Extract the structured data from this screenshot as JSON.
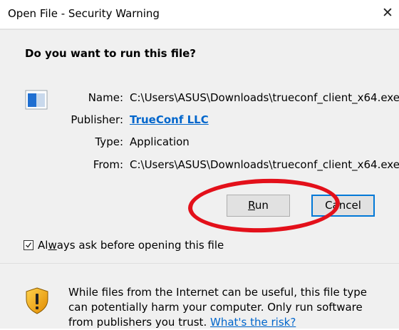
{
  "window": {
    "title": "Open File - Security Warning",
    "close_glyph": "✕"
  },
  "dialog": {
    "question": "Do you want to run this file?",
    "details": [
      {
        "label": "Name:",
        "value": "C:\\Users\\ASUS\\Downloads\\trueconf_client_x64.exe"
      },
      {
        "label": "Publisher:",
        "value": "TrueConf LLC"
      },
      {
        "label": "Type:",
        "value": "Application"
      },
      {
        "label": "From:",
        "value": "C:\\Users\\ASUS\\Downloads\\trueconf_client_x64.exe"
      }
    ],
    "run_button": {
      "pre": "",
      "mnemonic": "R",
      "post": "un"
    },
    "cancel_button": "Cancel",
    "checkbox": {
      "pre": "Al",
      "mnemonic": "w",
      "post": "ays ask before opening this file",
      "checked": true
    },
    "warning": {
      "text": "While files from the Internet can be useful, this file type can potentially harm your computer. Only run software from publishers you trust.",
      "link": "What's the risk?"
    }
  },
  "colors": {
    "link": "#0066cc",
    "highlight_circle": "#e3101a",
    "dialog_bg": "#f0f0f0",
    "default_button_border": "#0078d7"
  },
  "icons": {
    "app": "application-icon",
    "shield": "security-shield-icon",
    "close": "close-icon"
  }
}
